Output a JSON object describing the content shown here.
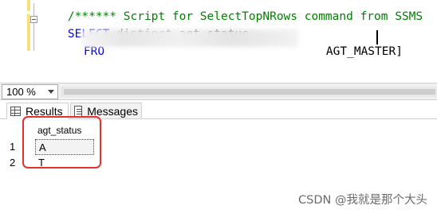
{
  "editor": {
    "line1": {
      "comment": "/****** Script for SelectTopNRows command from SSMS  **"
    },
    "line2": {
      "keyword": "SELECT",
      "distinct": "distinct",
      "column": "agt_status"
    },
    "line3": {
      "keyword": "FRO",
      "table": "AGT_MASTER]"
    }
  },
  "zoom": {
    "value": "100 %"
  },
  "tabs": {
    "results": "Results",
    "messages": "Messages"
  },
  "grid": {
    "column_header": "agt_status",
    "rows": [
      {
        "num": "1",
        "value": "A"
      },
      {
        "num": "2",
        "value": "T"
      }
    ]
  },
  "watermark": "CSDN @我就是那个大头",
  "colors": {
    "keyword": "#0000ff",
    "comment": "#008000",
    "highlight_box": "#e53030"
  }
}
